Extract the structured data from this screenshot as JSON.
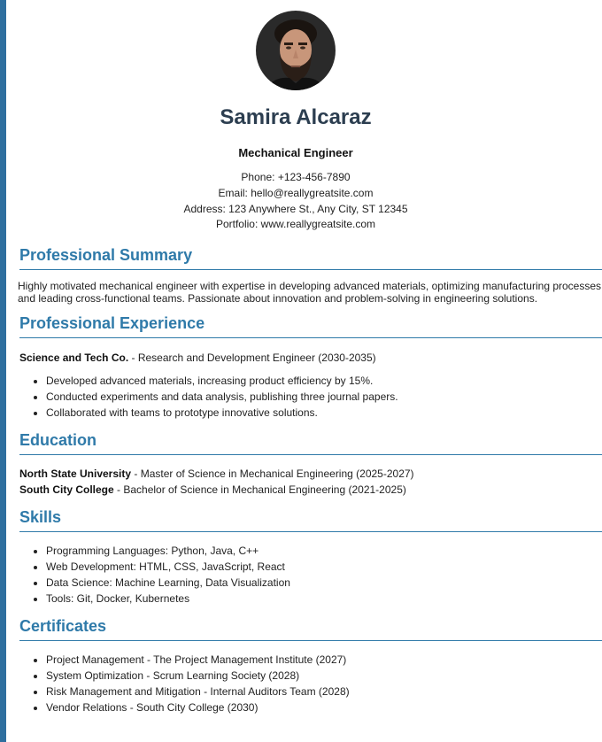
{
  "profile": {
    "name": "Samira Alcaraz",
    "job_title": "Mechanical Engineer",
    "phone_label": "Phone:",
    "phone": "+123-456-7890",
    "email_label": "Email:",
    "email": "hello@reallygreatsite.com",
    "address_label": "Address:",
    "address": "123 Anywhere St., Any City, ST 12345",
    "portfolio_label": "Portfolio:",
    "portfolio": "www.reallygreatsite.com"
  },
  "summary": {
    "heading": "Professional Summary",
    "line1": "Highly motivated mechanical engineer with expertise in developing advanced materials, optimizing manufacturing processes,",
    "line2": "and leading cross-functional teams. Passionate about innovation and problem-solving in engineering solutions."
  },
  "experience": {
    "heading": "Professional Experience",
    "company": "Science and Tech Co.",
    "role": " - Research and Development Engineer (2030-2035)",
    "bullets": [
      "Developed advanced materials, increasing product efficiency by 15%.",
      "Conducted experiments and data analysis, publishing three journal papers.",
      "Collaborated with teams to prototype innovative solutions."
    ]
  },
  "education": {
    "heading": "Education",
    "entries": [
      {
        "school": "North State University",
        "detail": " - Master of Science in Mechanical Engineering (2025-2027)"
      },
      {
        "school": "South City College",
        "detail": " - Bachelor of Science in Mechanical Engineering (2021-2025)"
      }
    ]
  },
  "skills": {
    "heading": "Skills",
    "items": [
      "Programming Languages: Python, Java, C++",
      "Web Development: HTML, CSS, JavaScript, React",
      "Data Science: Machine Learning, Data Visualization",
      "Tools: Git, Docker, Kubernetes"
    ]
  },
  "certificates": {
    "heading": "Certificates",
    "items": [
      "Project Management - The Project Management Institute (2027)",
      "System Optimization - Scrum Learning Society (2028)",
      "Risk Management and Mitigation - Internal Auditors Team (2028)",
      "Vendor Relations - South City College (2030)"
    ]
  },
  "colors": {
    "accent": "#2f7aa9",
    "sidebar": "#2f6f9f",
    "name": "#2c3e50"
  }
}
